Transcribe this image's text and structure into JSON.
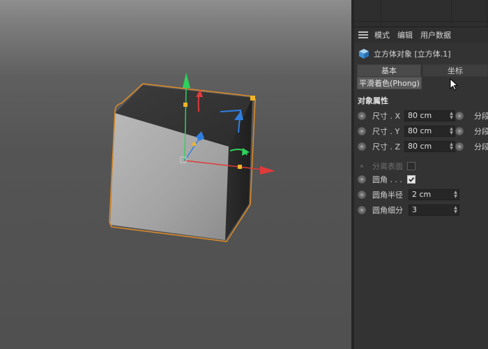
{
  "menubar": {
    "items": [
      "模式",
      "编辑",
      "用户数据"
    ]
  },
  "object": {
    "title": "立方体对象 [立方体.1]",
    "icon": "cube-icon"
  },
  "tabs": {
    "basic": "基本",
    "coord": "坐标",
    "phong": "平滑着色(Phong)"
  },
  "section": {
    "title": "对象属性"
  },
  "size": {
    "x": {
      "label": "尺寸 . X",
      "value": "80 cm",
      "segment_label": "分段"
    },
    "y": {
      "label": "尺寸 . Y",
      "value": "80 cm",
      "segment_label": "分段"
    },
    "z": {
      "label": "尺寸 . Z",
      "value": "80 cm",
      "segment_label": "分段"
    }
  },
  "options": {
    "separate_surfaces": {
      "label": "分离表面",
      "checked": false
    },
    "fillet": {
      "label": "圆角 . . .",
      "checked": true
    },
    "fillet_radius": {
      "label": "圆角半径",
      "value": "2 cm"
    },
    "fillet_subdivision": {
      "label": "圆角细分",
      "value": "3"
    }
  },
  "colors": {
    "selection_outline": "#d98a2b",
    "axis_x": "#e03a3a",
    "axis_y": "#2fd15a",
    "axis_z": "#2f7fe0",
    "handle": "#f0b428"
  }
}
